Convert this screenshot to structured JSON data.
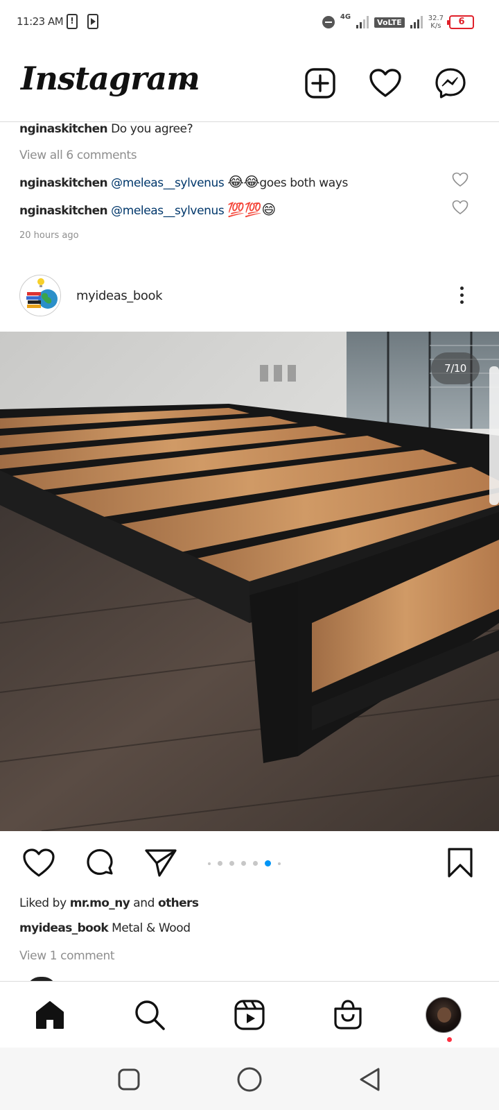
{
  "status_bar": {
    "time": "11:23 AM",
    "network_type": "4G",
    "volte": "VoLTE",
    "speed_value": "32.7",
    "speed_unit": "K/s",
    "battery": "6"
  },
  "header": {
    "logo": "Instagram",
    "icons": [
      "plus-square-icon",
      "heart-icon",
      "messenger-icon"
    ]
  },
  "previous_post": {
    "caption": {
      "user": "nginaskitchen",
      "text": "Do you agree?"
    },
    "view_all_comments": "View all 6 comments",
    "comments": [
      {
        "user": "nginaskitchen",
        "mention": "@meleas__sylvenus",
        "emoji": "😂😂",
        "text": "goes both ways"
      },
      {
        "user": "nginaskitchen",
        "mention": "@meleas__sylvenus",
        "emoji": "💯💯😄",
        "text": ""
      }
    ],
    "time_ago": "20 hours ago"
  },
  "post": {
    "username": "myideas_book",
    "carousel_counter": "7/10",
    "carousel": {
      "total": 10,
      "current": 7
    },
    "liked_by_prefix": "Liked by",
    "liked_by_user": "mr.mo_ny",
    "liked_by_and": "and",
    "liked_by_others": "others",
    "caption_user": "myideas_book",
    "caption_text": "Metal & Wood",
    "view_comments": "View 1 comment"
  },
  "bottom_nav": {
    "items": [
      "home-icon",
      "search-icon",
      "reels-icon",
      "shop-icon",
      "profile-avatar"
    ]
  },
  "colors": {
    "text": "#262626",
    "muted": "#8e8e8e",
    "mention": "#00376b",
    "active_dot": "#0095f6",
    "notification": "#ff3040",
    "battery_low": "#e0202a"
  }
}
